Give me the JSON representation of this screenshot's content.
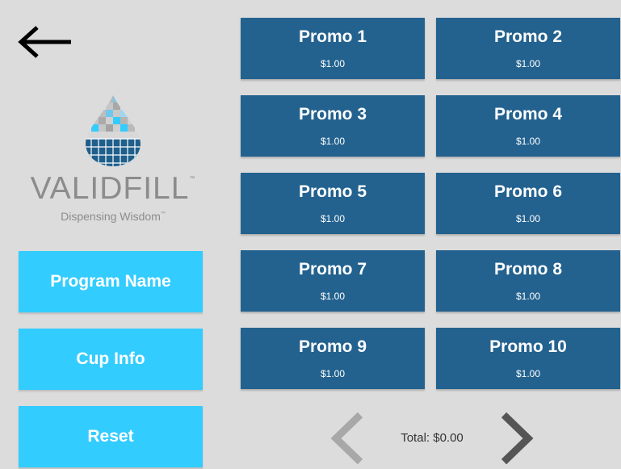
{
  "logo": {
    "wordmark": "VALIDFILL",
    "wordmark_tm": "™",
    "tagline": "Dispensing Wisdom",
    "tagline_tm": "™"
  },
  "sidebar": {
    "back_icon": "arrow-left-icon",
    "buttons": [
      {
        "label": "Program Name"
      },
      {
        "label": "Cup Info"
      },
      {
        "label": "Reset"
      }
    ]
  },
  "promos": [
    {
      "name": "Promo 1",
      "price": "$1.00"
    },
    {
      "name": "Promo 2",
      "price": "$1.00"
    },
    {
      "name": "Promo 3",
      "price": "$1.00"
    },
    {
      "name": "Promo 4",
      "price": "$1.00"
    },
    {
      "name": "Promo 5",
      "price": "$1.00"
    },
    {
      "name": "Promo 6",
      "price": "$1.00"
    },
    {
      "name": "Promo 7",
      "price": "$1.00"
    },
    {
      "name": "Promo 8",
      "price": "$1.00"
    },
    {
      "name": "Promo 9",
      "price": "$1.00"
    },
    {
      "name": "Promo 10",
      "price": "$1.00"
    }
  ],
  "footer": {
    "total": "Total: $0.00",
    "prev_icon": "chevron-left-icon",
    "next_icon": "chevron-right-icon"
  },
  "colors": {
    "background": "#dcdcdc",
    "side_button": "#33ccff",
    "promo_button": "#23628f",
    "logo_text": "#8c8c8c",
    "prev_disabled": "#a8a8a8",
    "next_active": "#555555"
  }
}
